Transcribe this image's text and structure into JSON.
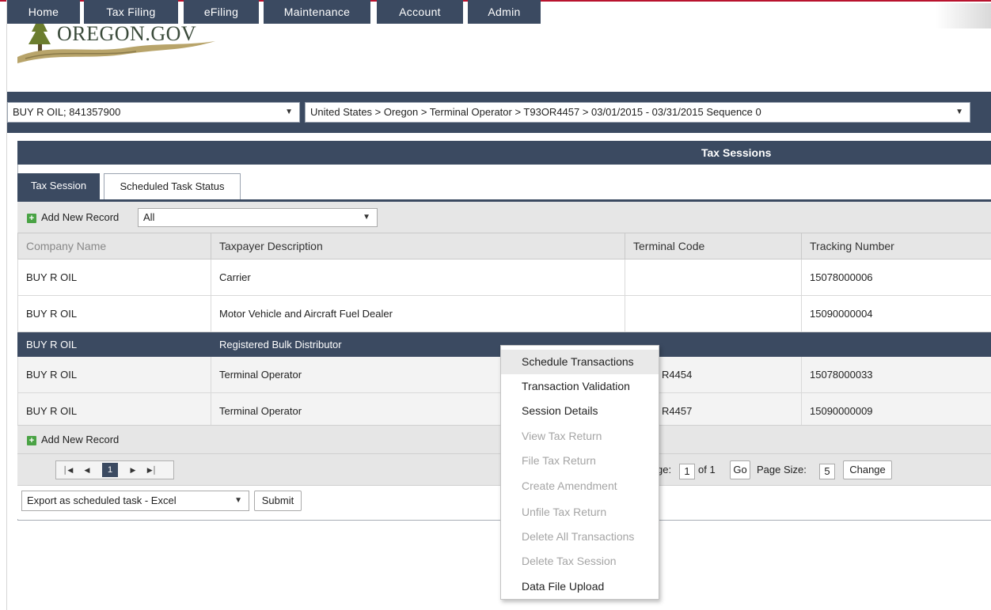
{
  "brand": {
    "logo_text": "OREGON.GOV"
  },
  "nav": [
    {
      "label": "Home"
    },
    {
      "label": "Tax Filing"
    },
    {
      "label": "eFiling"
    },
    {
      "label": "Maintenance"
    },
    {
      "label": "Account"
    },
    {
      "label": "Admin"
    }
  ],
  "context": {
    "company_select": "BUY R OIL; 841357900",
    "path_select": "United States > Oregon > Terminal Operator > T93OR4457 > 03/01/2015 - 03/31/2015 Sequence 0"
  },
  "panel": {
    "title": "Tax Sessions"
  },
  "tabs": [
    {
      "label": "Tax Session",
      "active": true
    },
    {
      "label": "Scheduled Task Status",
      "active": false
    }
  ],
  "toolbar": {
    "add_label": "Add New Record",
    "filter_value": "All"
  },
  "grid": {
    "columns": [
      "Company Name",
      "Taxpayer Description",
      "Terminal Code",
      "Tracking Number"
    ],
    "rows": [
      {
        "company": "BUY R OIL",
        "description": "Carrier",
        "terminal": "",
        "tracking": "15078000006"
      },
      {
        "company": "BUY R OIL",
        "description": "Motor Vehicle and Aircraft Fuel Dealer",
        "terminal": "",
        "tracking": "15090000004"
      },
      {
        "company": "BUY R OIL",
        "description": "Registered Bulk Distributor",
        "terminal": "",
        "tracking": ""
      },
      {
        "company": "BUY R OIL",
        "description": "Terminal Operator",
        "terminal": "R4454",
        "tracking": "15078000033"
      },
      {
        "company": "BUY R OIL",
        "description": "Terminal Operator",
        "terminal": "R4457",
        "tracking": "15090000009"
      }
    ]
  },
  "footer": {
    "add_label": "Add New Record"
  },
  "pager": {
    "current_page": "1",
    "page_label": "ge:",
    "page_value": "1",
    "of_label": "of 1",
    "go_label": "Go",
    "size_label": "Page Size:",
    "size_value": "5",
    "change_label": "Change"
  },
  "export": {
    "select_value": "Export as scheduled task - Excel",
    "submit_label": "Submit"
  },
  "context_menu": {
    "items": [
      {
        "label": "Schedule Transactions",
        "enabled": true
      },
      {
        "label": "Transaction Validation",
        "enabled": true
      },
      {
        "label": "Session Details",
        "enabled": true
      },
      {
        "label": "View Tax Return",
        "enabled": false
      },
      {
        "label": "File Tax Return",
        "enabled": false
      },
      {
        "label": "Create Amendment",
        "enabled": false
      },
      {
        "label": "Unfile Tax Return",
        "enabled": false
      },
      {
        "label": "Delete All Transactions",
        "enabled": false
      },
      {
        "label": "Delete Tax Session",
        "enabled": false
      },
      {
        "label": "Data File Upload",
        "enabled": true
      }
    ]
  },
  "colors": {
    "nav_bg": "#3b4a61",
    "accent_red": "#b9132e",
    "add_icon": "#4aa345"
  }
}
